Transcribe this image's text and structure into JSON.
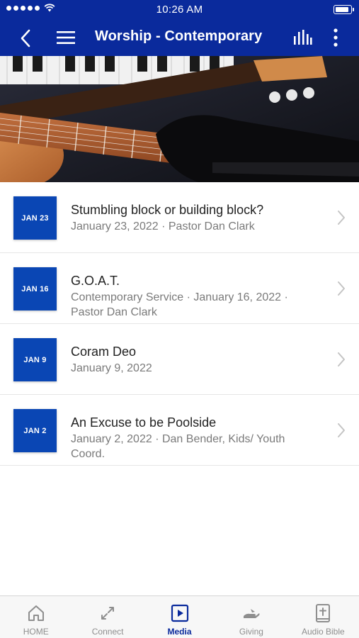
{
  "status_bar": {
    "time": "10:26 AM"
  },
  "nav": {
    "title": "Worship - Contemporary"
  },
  "items": [
    {
      "badge": "JAN 23",
      "title": "Stumbling block or building block?",
      "subtitle": "January 23, 2022 · Pastor Dan Clark"
    },
    {
      "badge": "JAN 16",
      "title": "G.O.A.T.",
      "subtitle": "Contemporary Service · January 16, 2022 · Pastor Dan Clark"
    },
    {
      "badge": "JAN 9",
      "title": "Coram Deo",
      "subtitle": "January 9, 2022"
    },
    {
      "badge": "JAN 2",
      "title": "An Excuse to be Poolside",
      "subtitle": "January 2, 2022 · Dan Bender, Kids/ Youth Coord."
    }
  ],
  "tabs": [
    {
      "label": "HOME",
      "icon": "home-icon"
    },
    {
      "label": "Connect",
      "icon": "connect-icon"
    },
    {
      "label": "Media",
      "icon": "media-play-icon",
      "active": true
    },
    {
      "label": "Giving",
      "icon": "giving-hand-icon"
    },
    {
      "label": "Audio Bible",
      "icon": "bible-icon"
    }
  ],
  "colors": {
    "brand": "#0a2a9c",
    "badge": "#0a46b4",
    "subtitle": "#7a7a7a",
    "tab_inactive": "#8e8e8e"
  }
}
